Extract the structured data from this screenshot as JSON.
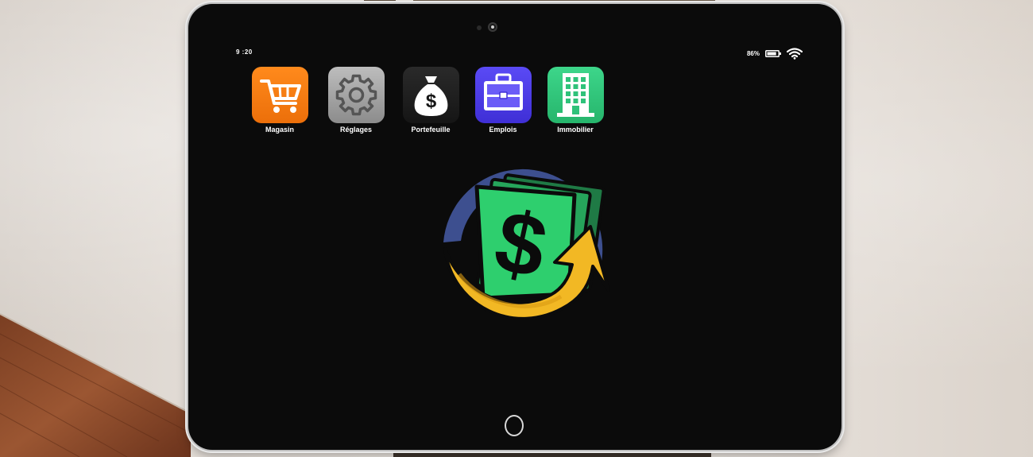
{
  "status_bar": {
    "time": "9 :20",
    "battery_percent": "86%",
    "battery_level": 0.86
  },
  "apps": [
    {
      "label": "Magasin",
      "icon": "shopping-cart-icon",
      "color": "#f07d14"
    },
    {
      "label": "Réglages",
      "icon": "gear-icon",
      "color": "#9e9e9e"
    },
    {
      "label": "Portefeuille",
      "icon": "money-bag-icon",
      "color": "#1e1e1e"
    },
    {
      "label": "Emplois",
      "icon": "briefcase-icon",
      "color": "#4f3de6"
    },
    {
      "label": "Immobilier",
      "icon": "building-icon",
      "color": "#2fc27a"
    }
  ],
  "center_logo": {
    "icon": "dollar-cycle-logo-icon"
  }
}
